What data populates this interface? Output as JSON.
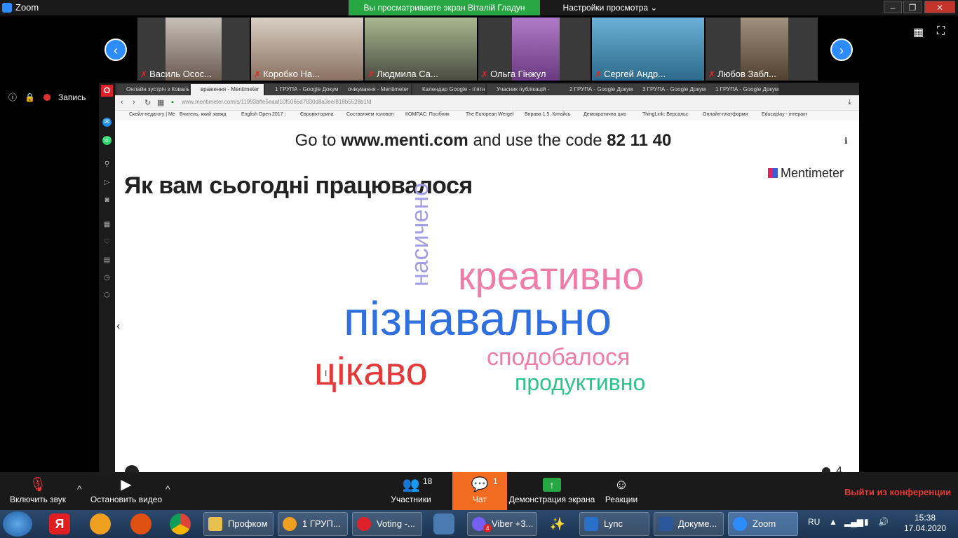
{
  "app": {
    "title": "Zoom",
    "share_banner": "Вы просматриваете экран Віталій Гладун",
    "view_options": "Настройки просмотра",
    "window_buttons": [
      "–",
      "❐",
      "✕"
    ]
  },
  "gallery": {
    "prev_icon": "‹",
    "next_icon": "›",
    "participants": [
      {
        "name": "Василь Осос..."
      },
      {
        "name": "Коробко На..."
      },
      {
        "name": "Людмила Са..."
      },
      {
        "name": "Ольга Гінжул"
      },
      {
        "name": "Сергей Андр..."
      },
      {
        "name": "Любов Забл..."
      }
    ],
    "mic_icon": "✗"
  },
  "meta": {
    "info_icon": "ⓘ",
    "lock_icon": "🔒",
    "record_label": "Запись"
  },
  "browser": {
    "opera_logo": "O",
    "tabs": [
      "Онлайн зустріч з Коваль",
      "враження - Mentimeter",
      "1 ГРУПА - Google Докум.",
      "очікування - Mentimeter",
      "Календар Google - п'ятн.",
      "Учасник публікацій -",
      "2 ГРУПА - Google Докум.",
      "3 ГРУПА - Google Докум.",
      "1 ГРУПА - Google Докум."
    ],
    "url": "www.mentimeter.com/s/11993bffe5eaaf10f5066d7830d8a3ee/818b5528b1fd",
    "bookmarks": [
      "Скейл-педагогу | Ме",
      "Вчитель, який завжд",
      "English Open 2017 :",
      "Євровікторина",
      "Составляем головол",
      "КОМПАС: Посібник",
      "The European Wergel",
      "Вправа 1.5. Китайсь",
      "Демократична шко",
      "ThingLink: Версальс",
      "Онлайн-платформи",
      "Educaplay - інтеракт"
    ]
  },
  "slide": {
    "code_prefix": "Go to",
    "code_site": "www.menti.com",
    "code_middle": "and use the code",
    "code_value": "82 11 40",
    "brand": "Mentimeter",
    "question": "Як вам сьогодні працювалося",
    "words": {
      "nasych": "насичено",
      "kreat": "креативно",
      "pizn": "пізнавально",
      "spod": "сподобалося",
      "tsik": "цікаво",
      "prod": "продуктивно"
    },
    "response_count": "4"
  },
  "toolbar": {
    "unmute_label": "Включить звук",
    "stop_video_label": "Остановить видео",
    "participants_label": "Участники",
    "participants_count": "18",
    "chat_label": "Чат",
    "chat_count": "1",
    "share_label": "Демонстрация экрана",
    "reactions_label": "Реакции",
    "leave_label": "Выйти из конференции"
  },
  "taskbar": {
    "items": [
      {
        "label": "Профком"
      },
      {
        "label": "1 ГРУП..."
      },
      {
        "label": "Voting -..."
      },
      {
        "label": "Viber +3..."
      },
      {
        "label": "Lync"
      },
      {
        "label": "Докуме..."
      },
      {
        "label": "Zoom"
      }
    ],
    "yandex_glyph": "Я",
    "viber_badge": "4",
    "lang": "RU",
    "time": "15:38",
    "date": "17.04.2020"
  },
  "colors": {
    "zoom_blue": "#2d8cff",
    "banner_green": "#26a744",
    "chat_orange": "#f26d21",
    "leave_red": "#e53a3a"
  }
}
